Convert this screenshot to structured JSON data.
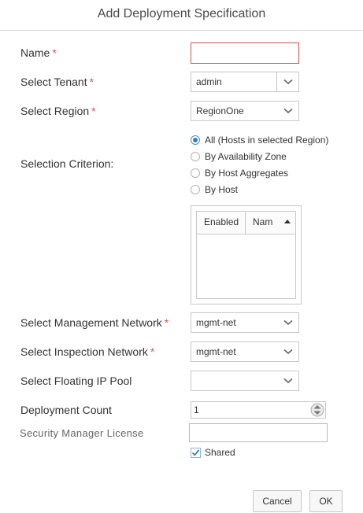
{
  "dialog": {
    "title": "Add Deployment Specification"
  },
  "form": {
    "name": {
      "label": "Name",
      "value": ""
    },
    "tenant": {
      "label": "Select Tenant",
      "value": "admin"
    },
    "region": {
      "label": "Select Region",
      "value": "RegionOne"
    },
    "criterion": {
      "label": "Selection Criterion:",
      "options": [
        "All (Hosts in selected Region)",
        "By Availability Zone",
        "By Host Aggregates",
        "By Host"
      ],
      "selected": "All (Hosts in selected Region)"
    },
    "hosts_table": {
      "columns": [
        "Enabled",
        "Nam"
      ]
    },
    "management_network": {
      "label": "Select Management Network",
      "value": "mgmt-net"
    },
    "inspection_network": {
      "label": "Select Inspection Network",
      "value": "mgmt-net"
    },
    "floating_ip_pool": {
      "label": "Select Floating IP Pool",
      "value": ""
    },
    "deployment_count": {
      "label": "Deployment Count",
      "value": "1"
    },
    "license": {
      "label": "Security Manager License",
      "value": ""
    },
    "shared": {
      "label": "Shared",
      "checked": true
    }
  },
  "required_marker": "*",
  "actions": {
    "cancel": "Cancel",
    "ok": "OK"
  },
  "colors": {
    "required": "#d9534f",
    "accent": "#2f7fc1"
  }
}
